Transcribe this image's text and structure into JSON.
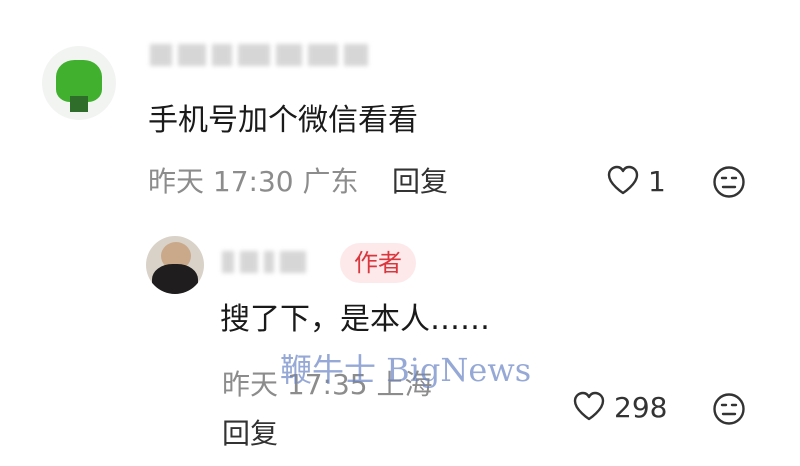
{
  "comment": {
    "text": "手机号加个微信看看",
    "time": "昨天 17:30",
    "location": "广东",
    "reply_label": "回复",
    "like_count": "1",
    "icons": {
      "like": "heart-outline-icon",
      "dislike": "neutral-face-icon"
    }
  },
  "reply": {
    "badge": "作者",
    "text": "搜了下，是本人……",
    "time": "昨天 17:35",
    "location": "上海",
    "reply_label": "回复",
    "like_count": "298",
    "icons": {
      "like": "heart-outline-icon",
      "dislike": "neutral-face-icon"
    }
  },
  "watermark": {
    "text": "鞭牛士 BigNews"
  },
  "colors": {
    "badge_bg": "#fde9ea",
    "badge_text": "#d9363e",
    "meta_text": "#8c8c8c",
    "watermark": "#6b86c6"
  }
}
